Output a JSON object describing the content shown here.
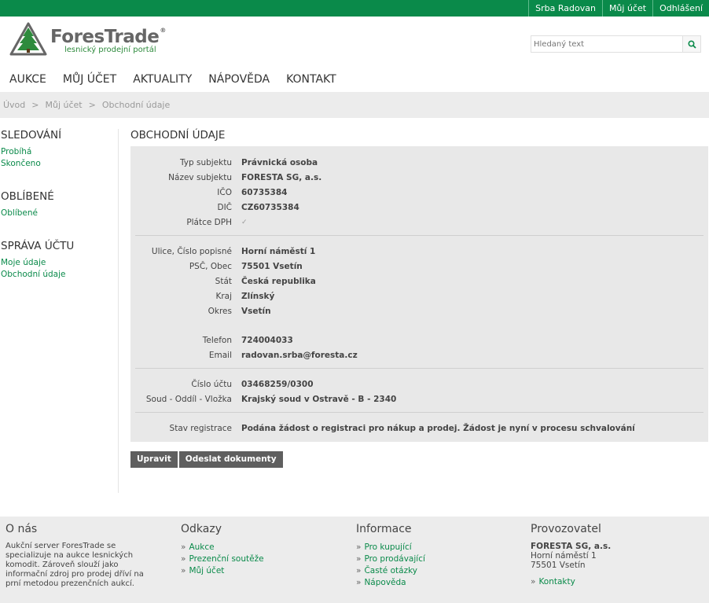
{
  "topbar": {
    "user": "Srba Radovan",
    "account": "Můj účet",
    "logout": "Odhlášení"
  },
  "logo": {
    "brand": "ForesTrade",
    "registered": "®",
    "tagline": "lesnický prodejní portál"
  },
  "search": {
    "placeholder": "Hledaný text",
    "icon": "search-icon"
  },
  "nav": {
    "items": [
      "AUKCE",
      "MŮJ ÚČET",
      "AKTUALITY",
      "NÁPOVĚDA",
      "KONTAKT"
    ]
  },
  "breadcrumb": {
    "items": [
      "Úvod",
      "Můj účet",
      "Obchodní údaje"
    ],
    "separator": ">"
  },
  "sidebar": {
    "groups": [
      {
        "title": "SLEDOVÁNÍ",
        "links": [
          "Probíhá",
          "Skončeno"
        ]
      },
      {
        "title": "OBLÍBENÉ",
        "links": [
          "Oblíbené"
        ]
      },
      {
        "title": "SPRÁVA ÚČTU",
        "links": [
          "Moje údaje",
          "Obchodní údaje"
        ]
      }
    ]
  },
  "content": {
    "title": "OBCHODNÍ ÚDAJE",
    "section1": [
      {
        "label": "Typ subjektu",
        "value": "Právnická osoba"
      },
      {
        "label": "Název subjektu",
        "value": "FORESTA SG, a.s."
      },
      {
        "label": "IČO",
        "value": "60735384"
      },
      {
        "label": "DIČ",
        "value": "CZ60735384"
      },
      {
        "label": "Plátce DPH",
        "value": "✓"
      }
    ],
    "section2": [
      {
        "label": "Ulice, Číslo popisné",
        "value": "Horní náměstí 1"
      },
      {
        "label": "PSČ, Obec",
        "value": "75501 Vsetín"
      },
      {
        "label": "Stát",
        "value": "Česká republika"
      },
      {
        "label": "Kraj",
        "value": "Zlínský"
      },
      {
        "label": "Okres",
        "value": "Vsetín"
      }
    ],
    "section3": [
      {
        "label": "Telefon",
        "value": "724004033"
      },
      {
        "label": "Email",
        "value": "radovan.srba@foresta.cz"
      }
    ],
    "section4": [
      {
        "label": "Číslo účtu",
        "value": "03468259/0300"
      },
      {
        "label": "Soud - Oddíl - Vložka",
        "value": "Krajský soud v Ostravě - B - 2340"
      }
    ],
    "section5": [
      {
        "label": "Stav registrace",
        "value": "Podána žádost o registraci pro nákup a prodej. Žádost je nyní v procesu schvalování"
      }
    ],
    "buttons": {
      "edit": "Upravit",
      "send": "Odeslat dokumenty"
    }
  },
  "footer": {
    "about": {
      "title": "O nás",
      "text": "Aukční server ForesTrade se specializuje na aukce lesnických komodit. Zároveň slouží jako informační zdroj pro prodej dříví na prní metodou prezenčních aukcí."
    },
    "links": {
      "title": "Odkazy",
      "items": [
        "Aukce",
        "Prezenční soutěže",
        "Můj účet"
      ]
    },
    "info": {
      "title": "Informace",
      "items": [
        "Pro kupující",
        "Pro prodávající",
        "Časté otázky",
        "Nápověda"
      ]
    },
    "operator": {
      "title": "Provozovatel",
      "name": "FORESTA SG, a.s.",
      "street": "Horní náměstí 1",
      "city": "75501 Vsetín",
      "contact": "Kontakty"
    },
    "arrow": "»"
  },
  "colors": {
    "accent": "#0a8a4a",
    "panel": "#e8e8e8",
    "button": "#5f5f5f"
  }
}
